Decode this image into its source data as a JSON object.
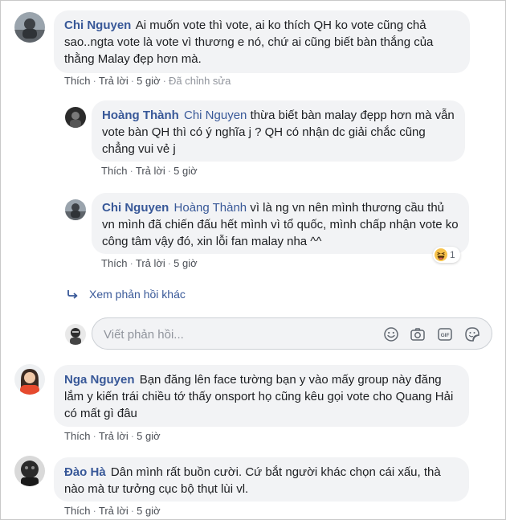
{
  "comments": [
    {
      "author": "Chi Nguyen",
      "text": "Ai muốn vote thì vote, ai ko thích QH ko vote cũng chả sao..ngta vote là vote vì thương e nó, chứ ai cũng biết bàn thắng của thằng Malay đẹp hơn mà.",
      "like": "Thích",
      "reply": "Trả lời",
      "time": "5 giờ",
      "edited": "Đã chỉnh sửa",
      "replies": [
        {
          "author": "Hoàng Thành",
          "mention": "Chi Nguyen",
          "text": "thừa biết bàn malay đẹpp hơn mà vẫn vote bàn QH thì có ý nghĩa j ? QH có nhận dc giải chắc cũng chẳng vui vẻ j",
          "like": "Thích",
          "reply": "Trả lời",
          "time": "5 giờ"
        },
        {
          "author": "Chi Nguyen",
          "mention": "Hoàng Thành",
          "text": "vì là ng vn nên mình thương cầu thủ vn mình đã chiến đấu hết mình vì tổ quốc, mình chấp nhận vote ko công tâm vậy đó, xin lỗi fan malay nha ^^",
          "like": "Thích",
          "reply": "Trả lời",
          "time": "5 giờ",
          "reaction": {
            "emoji": "haha-emoji-icon",
            "count": "1"
          }
        }
      ],
      "more_replies": "Xem phản hồi khác",
      "reply_placeholder": "Viết phản hồi..."
    },
    {
      "author": "Nga Nguyen",
      "text": "Bạn đăng lên face tường bạn y vào mấy group này đăng lắm y kiến trái chiều tớ thấy onsport họ cũng kêu gọi vote cho Quang Hải có mất gì đâu",
      "like": "Thích",
      "reply": "Trả lời",
      "time": "5 giờ"
    },
    {
      "author": "Đào Hà",
      "text": "Dân mình rất buồn cười. Cứ bắt người khác chọn cái xấu, thà nào mà tư tưởng cục bộ thụt lùi vl.",
      "like": "Thích",
      "reply": "Trả lời",
      "time": "5 giờ"
    }
  ],
  "icons": {
    "emoji": "emoji-icon",
    "camera": "camera-icon",
    "gif": "gif-icon",
    "sticker": "sticker-icon"
  },
  "colors": {
    "name_link": "#385898",
    "bubble_bg": "#f2f3f5",
    "text": "#1c1e21",
    "meta": "#616770"
  }
}
